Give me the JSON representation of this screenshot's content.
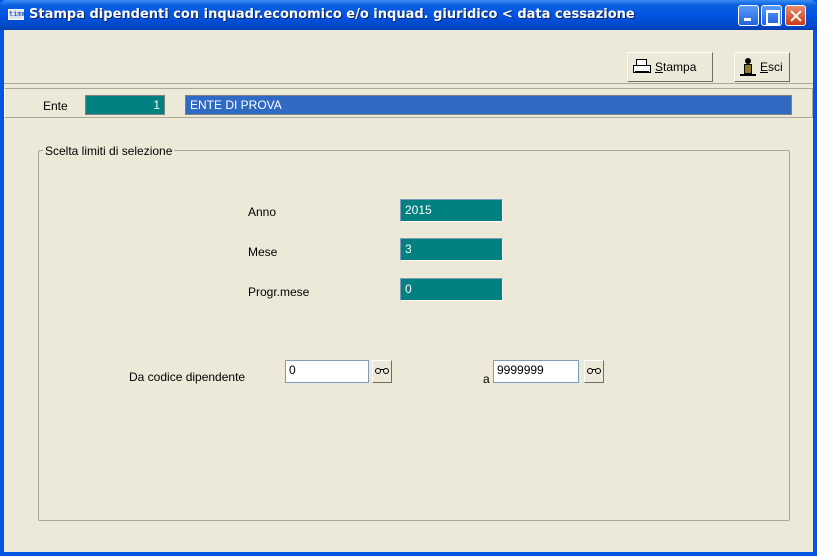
{
  "window": {
    "title": "Stampa dipendenti con inquadr.economico e/o inquad. giuridico < data cessazione",
    "icon_text": "timm"
  },
  "toolbar": {
    "stampa_prefix": "",
    "stampa_underlined": "S",
    "stampa_rest": "tampa",
    "esci_underlined": "E",
    "esci_rest": "sci"
  },
  "ente": {
    "label": "Ente",
    "code": "1",
    "name": "ENTE DI PROVA"
  },
  "selection": {
    "legend": "Scelta limiti di selezione",
    "anno_label": "Anno",
    "anno_value": "2015",
    "mese_label": "Mese",
    "mese_value": "3",
    "progr_label": "Progr.mese",
    "progr_value": "0",
    "da_codice_label": "Da codice dipendente",
    "da_codice_value": "0",
    "a_label": "a",
    "a_codice_value": "9999999"
  },
  "colors": {
    "title_bar": "#0054e3",
    "teal_field": "#008080",
    "ente_name_bg": "#316ac5",
    "window_bg": "#ece9d8"
  },
  "icons": [
    "printer-icon",
    "exit-icon",
    "binoculars-icon",
    "minimize-icon",
    "maximize-icon",
    "close-icon"
  ]
}
